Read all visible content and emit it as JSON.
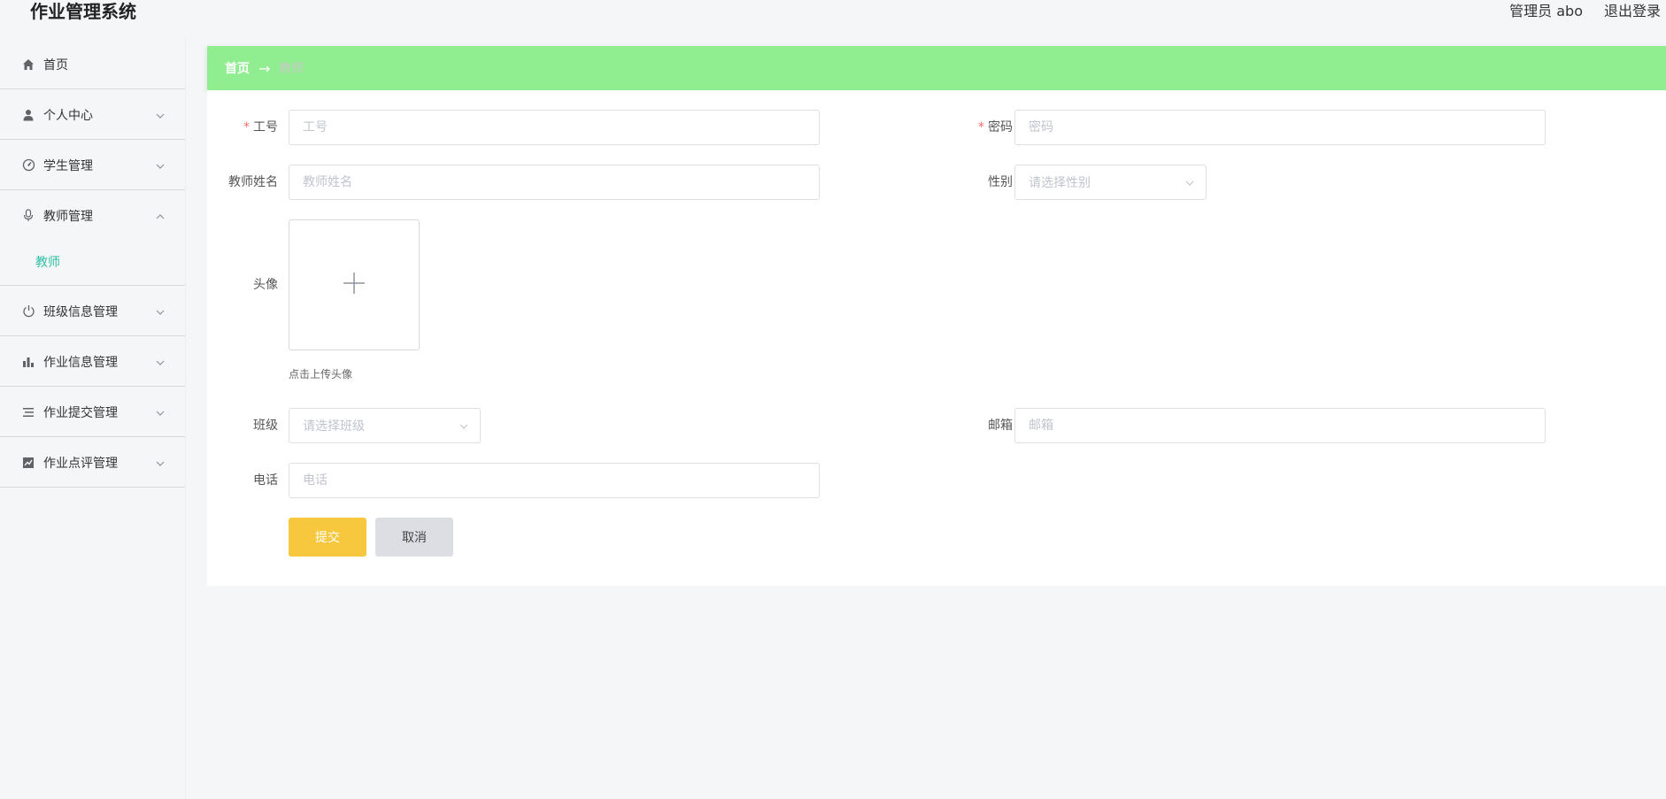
{
  "header": {
    "app_title": "作业管理系统",
    "user_label": "管理员 abo",
    "logout_label": "退出登录"
  },
  "sidebar": {
    "items": [
      {
        "label": "首页",
        "icon": "home-icon"
      },
      {
        "label": "个人中心",
        "icon": "user-icon"
      },
      {
        "label": "学生管理",
        "icon": "dashboard-icon"
      },
      {
        "label": "教师管理",
        "icon": "microphone-icon",
        "expanded": true,
        "children": [
          {
            "label": "教师"
          }
        ]
      },
      {
        "label": "班级信息管理",
        "icon": "power-icon"
      },
      {
        "label": "作业信息管理",
        "icon": "bar-chart-icon"
      },
      {
        "label": "作业提交管理",
        "icon": "list-icon"
      },
      {
        "label": "作业点评管理",
        "icon": "line-chart-icon"
      }
    ],
    "active_color": "#2ebfa4"
  },
  "breadcrumb": {
    "home": "首页",
    "separator": "→",
    "current": "教师",
    "bar_color": "#90ee90"
  },
  "form": {
    "employee_id": {
      "label": "工号",
      "placeholder": "工号",
      "value": "",
      "required": true
    },
    "password": {
      "label": "密码",
      "placeholder": "密码",
      "value": "",
      "required": true
    },
    "teacher_name": {
      "label": "教师姓名",
      "placeholder": "教师姓名",
      "value": ""
    },
    "gender": {
      "label": "性别",
      "placeholder": "请选择性别"
    },
    "avatar": {
      "label": "头像",
      "tip": "点击上传头像"
    },
    "class": {
      "label": "班级",
      "placeholder": "请选择班级"
    },
    "email": {
      "label": "邮箱",
      "placeholder": "邮箱",
      "value": ""
    },
    "phone": {
      "label": "电话",
      "placeholder": "电话",
      "value": ""
    },
    "submit_label": "提交",
    "cancel_label": "取消",
    "submit_color": "#f7c83d",
    "cancel_color": "#dcdee3"
  }
}
